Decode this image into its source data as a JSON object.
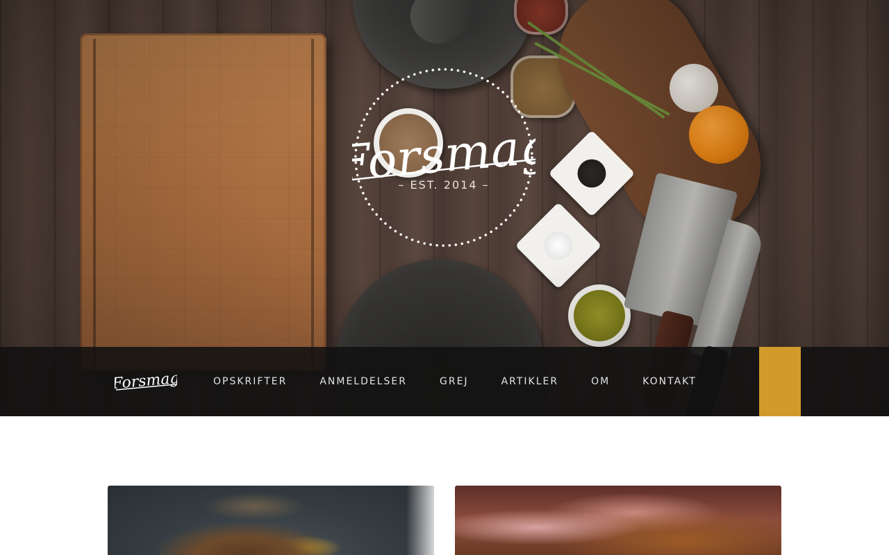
{
  "site": {
    "name": "Forsmag",
    "established": "– EST. 2014 –"
  },
  "nav": {
    "items": [
      {
        "label": "OPSKRIFTER"
      },
      {
        "label": "ANMELDELSER"
      },
      {
        "label": "GREJ"
      },
      {
        "label": "ARTIKLER"
      },
      {
        "label": "OM"
      },
      {
        "label": "KONTAKT"
      }
    ]
  },
  "colors": {
    "accent": "#d29a2a",
    "navbar": "#111111",
    "nav_text": "#e4e4e4"
  },
  "icons": {
    "search_block": "search-icon"
  }
}
